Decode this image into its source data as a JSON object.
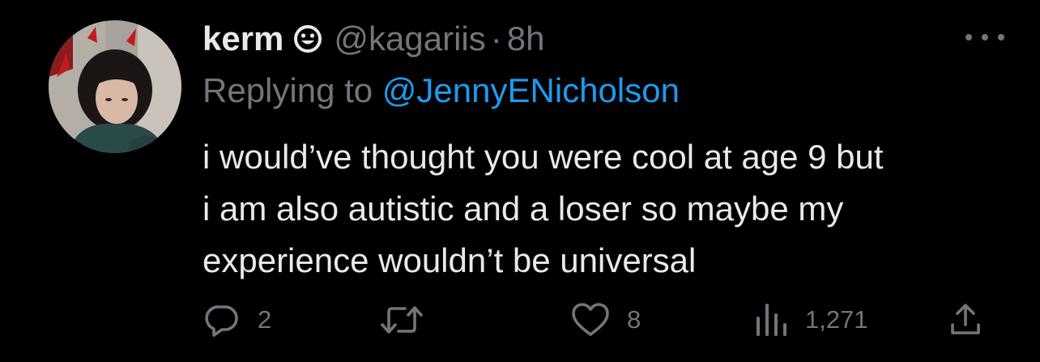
{
  "author": {
    "display_name": "kerm",
    "handle": "@kagariis",
    "separator": "·",
    "time_ago": "8h",
    "badge_icon": "smiley-face-icon"
  },
  "reply_context": {
    "prefix": "Replying to ",
    "mention": "@JennyENicholson"
  },
  "tweet": {
    "text": "i would’ve thought you were cool at age 9 but\ni am also autistic and a loser so maybe my\nexperience wouldn’t be universal"
  },
  "actions": {
    "replies": "2",
    "retweets": "",
    "likes": "8",
    "views": "1,271"
  },
  "colors": {
    "background": "#000000",
    "primary_text": "#e7e9ea",
    "secondary_text": "#71767b",
    "link": "#1d9bf0"
  },
  "icons": {
    "more": "more-dots-icon",
    "reply": "reply-bubble-icon",
    "retweet": "retweet-icon",
    "like": "heart-icon",
    "views": "bar-chart-icon",
    "share": "share-upload-icon"
  }
}
